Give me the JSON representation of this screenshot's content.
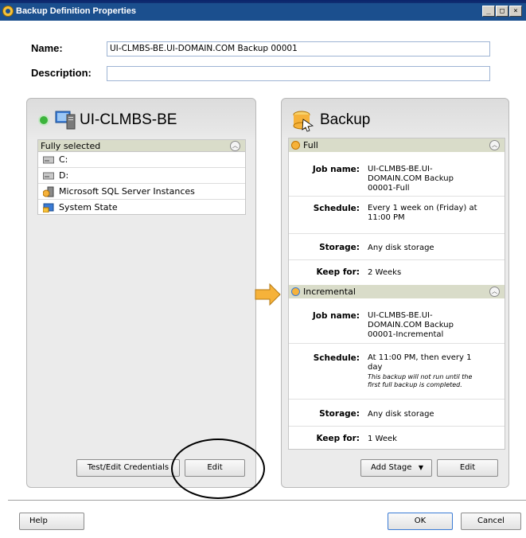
{
  "window": {
    "title": "Backup Definition Properties",
    "min": "_",
    "max": "□",
    "close": "×"
  },
  "form": {
    "name_label": "Name:",
    "name_value": "UI-CLMBS-BE.UI-DOMAIN.COM Backup 00001",
    "description_label": "Description:",
    "description_value": ""
  },
  "left_panel": {
    "title": "UI-CLMBS-BE",
    "list_header": "Fully selected",
    "items": [
      "C:",
      "D:",
      "Microsoft SQL Server Instances",
      "System State"
    ],
    "test_button": "Test/Edit Credentials",
    "edit_button": "Edit"
  },
  "right_panel": {
    "title": "Backup",
    "stages": [
      {
        "name": "Full",
        "job_name_label": "Job name:",
        "job_name": [
          "UI-CLMBS-BE.UI-",
          "DOMAIN.COM Backup",
          "00001-Full"
        ],
        "schedule_label": "Schedule:",
        "schedule": [
          "Every 1 week on (Friday) at",
          "11:00 PM"
        ],
        "storage_label": "Storage:",
        "storage": "Any disk storage",
        "keep_label": "Keep for:",
        "keep": "2 Weeks"
      },
      {
        "name": "Incremental",
        "job_name_label": "Job name:",
        "job_name": [
          "UI-CLMBS-BE.UI-",
          "DOMAIN.COM Backup",
          "00001-Incremental"
        ],
        "schedule_label": "Schedule:",
        "schedule": [
          "At 11:00 PM, then every 1",
          "day"
        ],
        "schedule_note": [
          "This backup will not run until the",
          "first full backup is completed."
        ],
        "storage_label": "Storage:",
        "storage": "Any disk storage",
        "keep_label": "Keep for:",
        "keep": "1 Week"
      }
    ],
    "add_stage_button": "Add Stage",
    "edit_button": "Edit"
  },
  "footer": {
    "help": "Help",
    "ok": "OK",
    "cancel": "Cancel"
  },
  "colors": {
    "title_bar": "#1b4f8e",
    "list_header": "#d9dcc9",
    "arrow": "#f6b23a"
  },
  "icons": [
    "backup-exec-icon",
    "server-icon",
    "drive-icon",
    "sql-icon",
    "system-state-icon",
    "backup-icon",
    "arrow-right-icon",
    "collapse-icon",
    "dropdown-arrow-icon"
  ]
}
